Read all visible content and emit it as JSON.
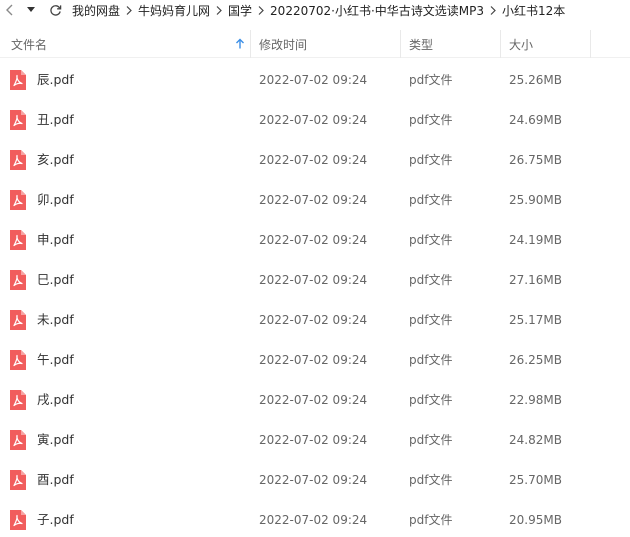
{
  "breadcrumb": {
    "items": [
      "我的网盘",
      "牛妈妈育儿网",
      "国学",
      "20220702·小红书·中华古诗文选读MP3",
      "小红书12本"
    ]
  },
  "header": {
    "name": "文件名",
    "date": "修改时间",
    "type": "类型",
    "size": "大小"
  },
  "colors": {
    "pdf_icon": "#f15d5d",
    "sort_arrow": "#3a8ee6",
    "text_primary": "#333333",
    "text_secondary": "#666666"
  },
  "files": [
    {
      "name": "辰.pdf",
      "date": "2022-07-02 09:24",
      "type": "pdf文件",
      "size": "25.26MB",
      "icon": "pdf-icon"
    },
    {
      "name": "丑.pdf",
      "date": "2022-07-02 09:24",
      "type": "pdf文件",
      "size": "24.69MB",
      "icon": "pdf-icon"
    },
    {
      "name": "亥.pdf",
      "date": "2022-07-02 09:24",
      "type": "pdf文件",
      "size": "26.75MB",
      "icon": "pdf-icon"
    },
    {
      "name": "卯.pdf",
      "date": "2022-07-02 09:24",
      "type": "pdf文件",
      "size": "25.90MB",
      "icon": "pdf-icon"
    },
    {
      "name": "申.pdf",
      "date": "2022-07-02 09:24",
      "type": "pdf文件",
      "size": "24.19MB",
      "icon": "pdf-icon"
    },
    {
      "name": "巳.pdf",
      "date": "2022-07-02 09:24",
      "type": "pdf文件",
      "size": "27.16MB",
      "icon": "pdf-icon"
    },
    {
      "name": "未.pdf",
      "date": "2022-07-02 09:24",
      "type": "pdf文件",
      "size": "25.17MB",
      "icon": "pdf-icon"
    },
    {
      "name": "午.pdf",
      "date": "2022-07-02 09:24",
      "type": "pdf文件",
      "size": "26.25MB",
      "icon": "pdf-icon"
    },
    {
      "name": "戌.pdf",
      "date": "2022-07-02 09:24",
      "type": "pdf文件",
      "size": "22.98MB",
      "icon": "pdf-icon"
    },
    {
      "name": "寅.pdf",
      "date": "2022-07-02 09:24",
      "type": "pdf文件",
      "size": "24.82MB",
      "icon": "pdf-icon"
    },
    {
      "name": "酉.pdf",
      "date": "2022-07-02 09:24",
      "type": "pdf文件",
      "size": "25.70MB",
      "icon": "pdf-icon"
    },
    {
      "name": "子.pdf",
      "date": "2022-07-02 09:24",
      "type": "pdf文件",
      "size": "20.95MB",
      "icon": "pdf-icon"
    }
  ]
}
